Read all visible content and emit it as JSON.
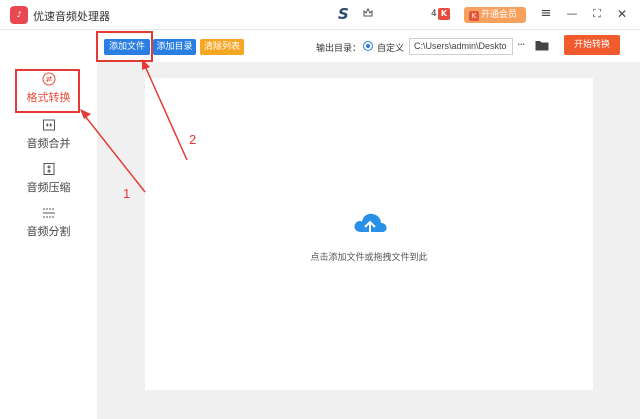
{
  "titlebar": {
    "app_title": "优速音频处理器",
    "app_logo": "♪",
    "badge_count": "4",
    "vip_label": "开通会员",
    "vip_icon": "K",
    "brand_mark": "S",
    "menu_icon": "≡",
    "minimize_icon": "—",
    "maximize_icon": "⛶",
    "close_icon": "✕"
  },
  "sidebar": {
    "items": [
      {
        "label": "格式转换",
        "icon": "refresh-circle-icon",
        "active": true
      },
      {
        "label": "音频合并",
        "icon": "merge-icon",
        "active": false
      },
      {
        "label": "音频压缩",
        "icon": "compress-icon",
        "active": false
      },
      {
        "label": "音频分割",
        "icon": "split-icon",
        "active": false
      }
    ]
  },
  "toolbar": {
    "add_file": "添加文件",
    "add_folder": "添加目录",
    "clear_list": "清除列表",
    "output_label": "输出目录：",
    "custom_label": "自定义",
    "output_path": "C:\\Users\\admin\\Deskto",
    "more": "···",
    "convert": "开始转换"
  },
  "main": {
    "drop_hint": "点击添加文件或拖拽文件到此"
  },
  "annotations": {
    "num1": "1",
    "num2": "2"
  },
  "colors": {
    "accent_red": "#e84c3d",
    "btn_blue": "#2a7de1",
    "btn_orange": "#f5a623",
    "convert_orange": "#f05a2c",
    "annotation_red": "#e53935"
  }
}
